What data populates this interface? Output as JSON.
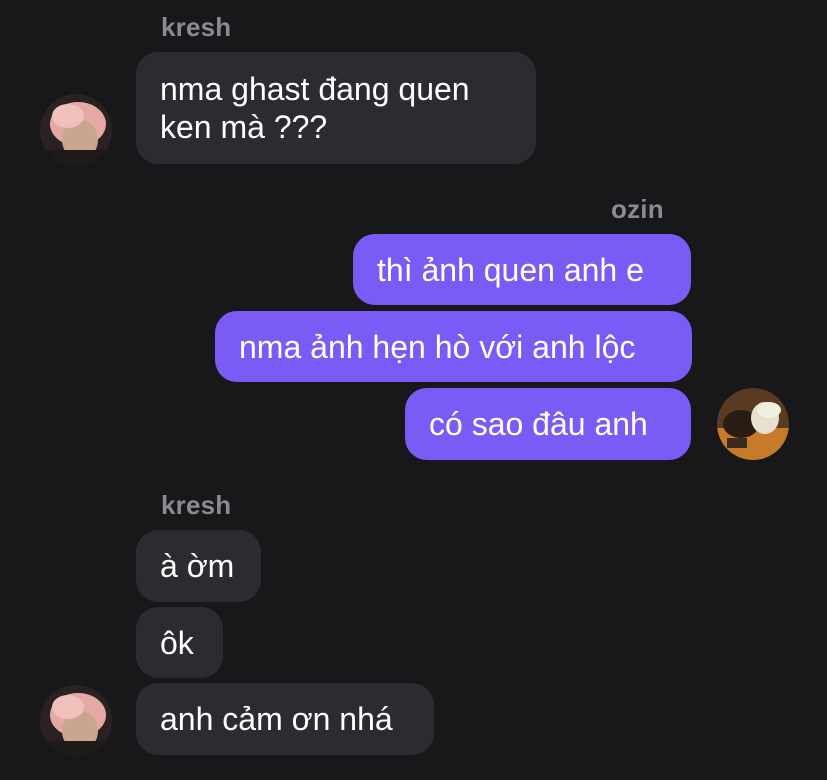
{
  "thread": {
    "group1": {
      "sender": "kresh",
      "messages": [
        "nma ghast đang quen",
        "ken mà ???"
      ]
    },
    "group2": {
      "sender": "ozin",
      "messages": [
        "thì ảnh quen anh e",
        "nma ảnh hẹn hò với anh lộc",
        "có sao đâu anh"
      ]
    },
    "group3": {
      "sender": "kresh",
      "messages": [
        "à ờm",
        "ôk",
        "anh cảm ơn nhá"
      ]
    }
  },
  "colors": {
    "background": "#18171a",
    "incoming_bubble": "#2c2b30",
    "outgoing_bubble": "#7b5bf5",
    "sender_name": "#8b8a90"
  }
}
